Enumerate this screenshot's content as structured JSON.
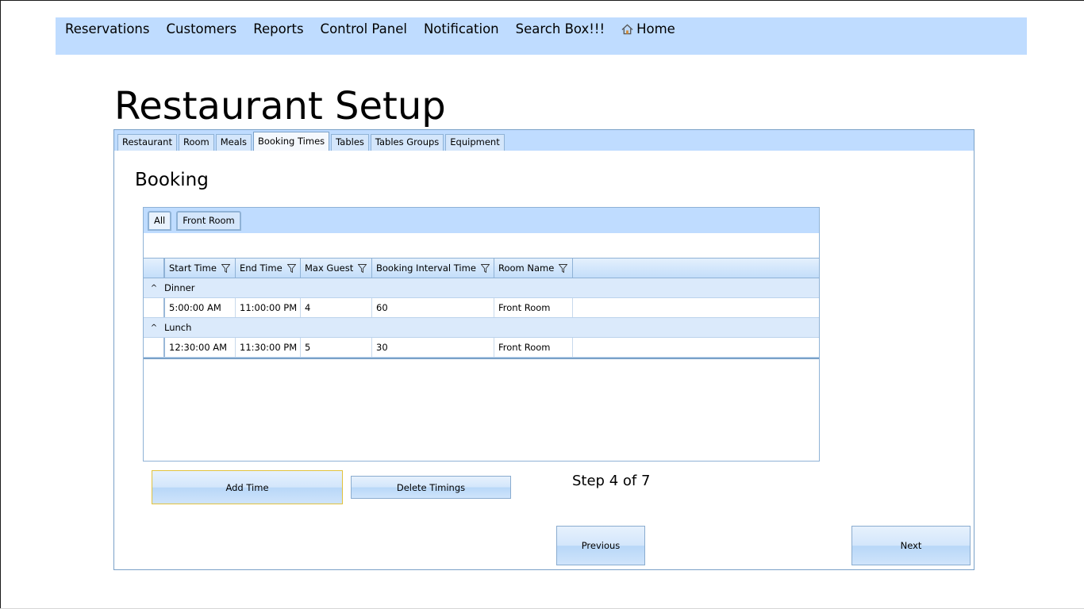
{
  "nav": {
    "items": [
      "Reservations",
      "Customers",
      "Reports",
      "Control Panel",
      "Notification",
      "Search Box!!!"
    ],
    "home_label": "Home"
  },
  "page_title": "Restaurant Setup",
  "setup_tabs": [
    "Restaurant",
    "Room",
    "Meals",
    "Booking Times",
    "Tables",
    "Tables Groups",
    "Equipment"
  ],
  "active_setup_tab": "Booking Times",
  "section_title": "Booking",
  "inner_tabs": [
    "All",
    "Front Room"
  ],
  "grid": {
    "columns": [
      "Start Time",
      "End Time",
      "Max Guest",
      "Booking Interval Time",
      "Room Name"
    ],
    "groups": [
      {
        "name": "Dinner",
        "rows": [
          [
            "5:00:00 AM",
            "11:00:00 PM",
            "4",
            "60",
            "Front Room"
          ]
        ]
      },
      {
        "name": "Lunch",
        "rows": [
          [
            "12:30:00 AM",
            "11:30:00 PM",
            "5",
            "30",
            "Front Room"
          ]
        ]
      }
    ]
  },
  "buttons": {
    "add_time": "Add Time",
    "delete_timings": "Delete Timings",
    "previous": "Previous",
    "next": "Next"
  },
  "step_text": "Step 4 of 7",
  "colors": {
    "nav_bg": "#bfdcff",
    "panel_border": "#7aa1c8",
    "focus_border": "#e2c23c"
  },
  "icons": {
    "home": "home-icon",
    "filter": "filter-icon",
    "collapse": "chevron-up-icon"
  }
}
